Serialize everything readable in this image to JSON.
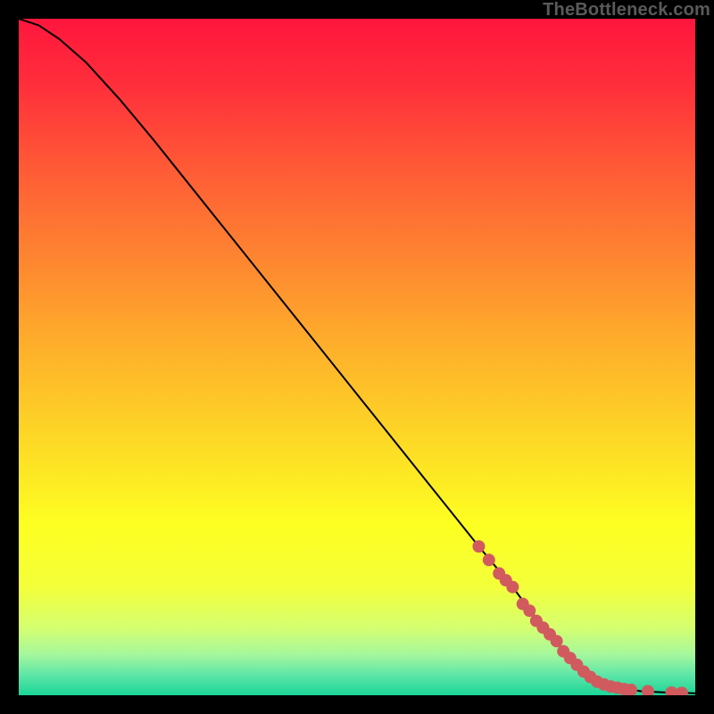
{
  "watermark": "TheBottleneck.com",
  "chart_data": {
    "type": "line",
    "title": "",
    "xlabel": "",
    "ylabel": "",
    "xlim": [
      0,
      100
    ],
    "ylim": [
      0,
      100
    ],
    "grid": false,
    "legend": false,
    "series": [
      {
        "name": "curve",
        "x": [
          0,
          3,
          6,
          10,
          15,
          20,
          30,
          40,
          50,
          60,
          68,
          73,
          76,
          79,
          81,
          83,
          85,
          88,
          92,
          96,
          100
        ],
        "y": [
          100,
          99,
          97,
          93.5,
          88,
          82,
          69.5,
          57,
          44.5,
          32,
          22,
          16,
          12,
          8.5,
          6,
          4,
          2.5,
          1.2,
          0.6,
          0.4,
          0.3
        ]
      }
    ],
    "markers": {
      "name": "highlight-dots",
      "color": "#d15a5f",
      "points": [
        {
          "x": 68,
          "y": 22
        },
        {
          "x": 69.5,
          "y": 20
        },
        {
          "x": 71,
          "y": 18
        },
        {
          "x": 72,
          "y": 17
        },
        {
          "x": 73,
          "y": 16
        },
        {
          "x": 74.5,
          "y": 13.5
        },
        {
          "x": 75.5,
          "y": 12.5
        },
        {
          "x": 76.5,
          "y": 11
        },
        {
          "x": 77.5,
          "y": 10
        },
        {
          "x": 78.5,
          "y": 9
        },
        {
          "x": 79.5,
          "y": 8
        },
        {
          "x": 80.5,
          "y": 6.5
        },
        {
          "x": 81.5,
          "y": 5.5
        },
        {
          "x": 82.5,
          "y": 4.5
        },
        {
          "x": 83.5,
          "y": 3.5
        },
        {
          "x": 84.5,
          "y": 2.7
        },
        {
          "x": 85.5,
          "y": 2.0
        },
        {
          "x": 86.5,
          "y": 1.6
        },
        {
          "x": 87.5,
          "y": 1.3
        },
        {
          "x": 88.5,
          "y": 1.1
        },
        {
          "x": 89.5,
          "y": 0.9
        },
        {
          "x": 90.5,
          "y": 0.8
        },
        {
          "x": 93,
          "y": 0.6
        },
        {
          "x": 96.5,
          "y": 0.4
        },
        {
          "x": 98,
          "y": 0.35
        }
      ]
    },
    "background_gradient": {
      "stops": [
        {
          "offset": 0.0,
          "color": "#ff163d"
        },
        {
          "offset": 0.1,
          "color": "#ff2f3b"
        },
        {
          "offset": 0.22,
          "color": "#ff5a36"
        },
        {
          "offset": 0.35,
          "color": "#fe8431"
        },
        {
          "offset": 0.48,
          "color": "#feae2b"
        },
        {
          "offset": 0.62,
          "color": "#fdd826"
        },
        {
          "offset": 0.75,
          "color": "#fdff21"
        },
        {
          "offset": 0.84,
          "color": "#f3ff3a"
        },
        {
          "offset": 0.9,
          "color": "#d5ff70"
        },
        {
          "offset": 0.94,
          "color": "#a5f79d"
        },
        {
          "offset": 0.97,
          "color": "#5ee6a7"
        },
        {
          "offset": 1.0,
          "color": "#1ad598"
        }
      ]
    }
  }
}
